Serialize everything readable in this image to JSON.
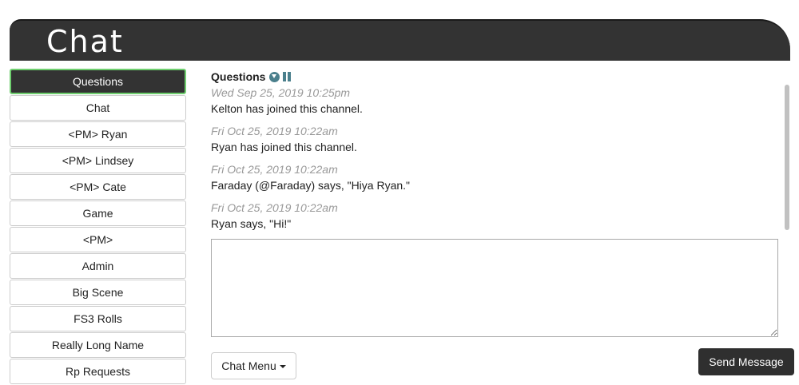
{
  "header": {
    "title": "Chat"
  },
  "sidebar": {
    "channels": [
      {
        "label": "Questions"
      },
      {
        "label": "Chat"
      },
      {
        "label": "<PM> Ryan"
      },
      {
        "label": "<PM> Lindsey"
      },
      {
        "label": "<PM> Cate"
      },
      {
        "label": "Game"
      },
      {
        "label": "<PM>"
      },
      {
        "label": "Admin"
      },
      {
        "label": "Big Scene"
      },
      {
        "label": "FS3 Rolls"
      },
      {
        "label": "Really Long Name"
      },
      {
        "label": "Rp Requests"
      }
    ],
    "active_channel": "Questions"
  },
  "channel": {
    "name": "Questions",
    "icons": [
      "chevron-down-circle-icon",
      "pause-icon"
    ],
    "icon_color": "#4a7f8c"
  },
  "messages": [
    {
      "timestamp": "Wed Sep 25, 2019 10:25pm",
      "text": "Kelton has joined this channel."
    },
    {
      "timestamp": "Fri Oct 25, 2019 10:22am",
      "text": "Ryan has joined this channel."
    },
    {
      "timestamp": "Fri Oct 25, 2019 10:22am",
      "text": "Faraday (@Faraday) says, \"Hiya Ryan.\""
    },
    {
      "timestamp": "Fri Oct 25, 2019 10:22am",
      "text": "Ryan says, \"Hi!\""
    }
  ],
  "input": {
    "value": "",
    "placeholder": ""
  },
  "footer": {
    "menu_label": "Chat Menu",
    "send_label": "Send Message"
  },
  "colors": {
    "header_bg": "#333333",
    "active_border": "#6fcf6f",
    "send_bg": "#2f2f2f"
  }
}
